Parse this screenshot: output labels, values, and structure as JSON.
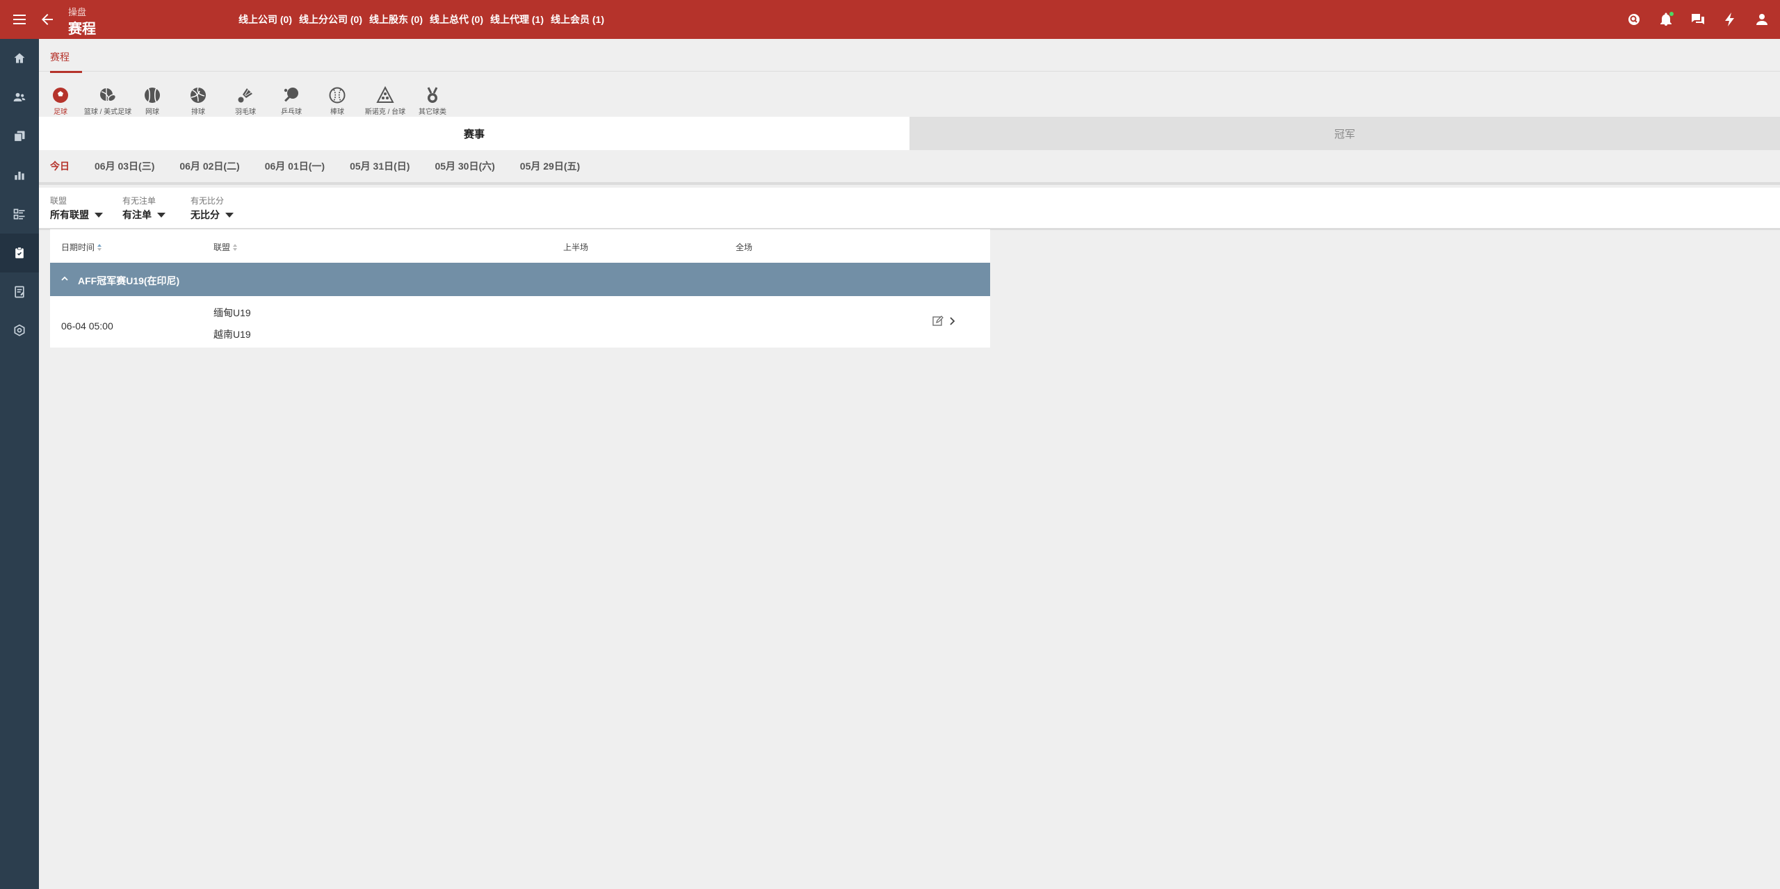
{
  "topbar": {
    "breadcrumb_small": "操盘",
    "title": "赛程",
    "online_links": [
      "线上公司 (0)",
      "线上分公司 (0)",
      "线上股东 (0)",
      "线上总代 (0)",
      "线上代理 (1)",
      "线上会员 (1)"
    ],
    "icons": [
      "search-icon",
      "bell-icon",
      "chat-icon",
      "lightning-icon",
      "user-icon"
    ]
  },
  "sidebar": {
    "items": [
      "home-icon",
      "users-icon",
      "copy-icon",
      "bar-chart-icon",
      "list-icon",
      "clipboard-icon",
      "notebook-icon",
      "settings-icon"
    ],
    "active_index": 5
  },
  "page_tab": "赛程",
  "sports": [
    {
      "label": "足球",
      "icon": "soccer-icon"
    },
    {
      "label": "篮球 / 美式足球",
      "icon": "basketball-football-icon"
    },
    {
      "label": "网球",
      "icon": "tennis-icon"
    },
    {
      "label": "排球",
      "icon": "volleyball-icon"
    },
    {
      "label": "羽毛球",
      "icon": "badminton-icon"
    },
    {
      "label": "乒乓球",
      "icon": "table-tennis-icon"
    },
    {
      "label": "棒球",
      "icon": "baseball-icon"
    },
    {
      "label": "斯诺克 / 台球",
      "icon": "snooker-icon"
    },
    {
      "label": "其它球类",
      "icon": "medal-icon"
    }
  ],
  "mode_tabs": {
    "matches": "赛事",
    "champion": "冠军"
  },
  "date_tabs": [
    "今日",
    "06月 03日(三)",
    "06月 02日(二)",
    "06月 01日(一)",
    "05月 31日(日)",
    "05月 30日(六)",
    "05月 29日(五)"
  ],
  "filters": {
    "league": {
      "label": "联盟",
      "value": "所有联盟"
    },
    "bet": {
      "label": "有无注单",
      "value": "有注单"
    },
    "score": {
      "label": "有无比分",
      "value": "无比分"
    }
  },
  "table": {
    "headers": {
      "datetime": "日期时间",
      "league": "联盟",
      "first_half": "上半场",
      "full": "全场"
    },
    "group": {
      "name": "AFF冠军赛U19(在印尼)"
    },
    "match": {
      "time": "06-04 05:00",
      "home": "缅甸U19",
      "away": "越南U19"
    }
  },
  "colors": {
    "brand": "#b5332b",
    "sidebar": "#2c3e4e",
    "group_row": "#728fa6"
  }
}
